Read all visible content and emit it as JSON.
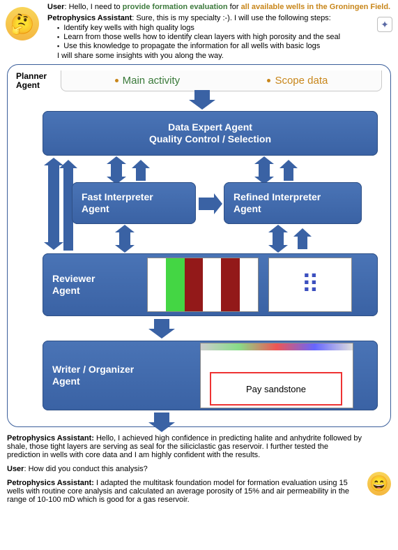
{
  "conversation_top": {
    "user": {
      "label": "User",
      "text_pre": ": Hello, I need to ",
      "hl1": "provide formation evaluation",
      "text_mid": " for ",
      "hl2": "all available wells in the Groningen Field."
    },
    "assistant": {
      "label": "Petrophysics Assistant",
      "intro": ": Sure, this is my specialty :-). I will use the following steps:",
      "steps": [
        "Identify key wells with high quality logs",
        "Learn from those wells how to identify clean layers with high porosity and the seal",
        "Use this knowledge to propagate the information for all wells with basic logs"
      ],
      "closing": "I will share some insights with you along the way."
    }
  },
  "flow": {
    "planner_label": "Planner Agent",
    "scope": {
      "main": "Main activity",
      "data": "Scope data"
    },
    "agents": {
      "data_expert_l1": "Data Expert Agent",
      "data_expert_l2": "Quality Control / Selection",
      "fast_l1": "Fast Interpreter",
      "fast_l2": "Agent",
      "refined_l1": "Refined Interpreter",
      "refined_l2": "Agent",
      "reviewer_l1": "Reviewer",
      "reviewer_l2": "Agent",
      "writer_l1": "Writer / Organizer",
      "writer_l2": "Agent"
    },
    "pay_label": "Pay sandstone"
  },
  "conversation_bottom": {
    "a1": {
      "label": "Petrophysics Assistant:",
      "text": " Hello, I achieved high confidence in predicting halite and anhydrite followed by shale, those tight layers  are serving as seal for the siliciclastic gas reservoir. I further tested the prediction in wells with core data and I am highly confident with the results."
    },
    "u1": {
      "label": "User",
      "text": ": How did you conduct this analysis?"
    },
    "a2": {
      "label": "Petrophysics Assistant:",
      "text": " I adapted the multitask foundation model for formation evaluation using 15 wells with routine core analysis and calculated an average porosity of 15% and air permeability in the range of 10-100 mD which is good for a gas reservoir."
    }
  }
}
